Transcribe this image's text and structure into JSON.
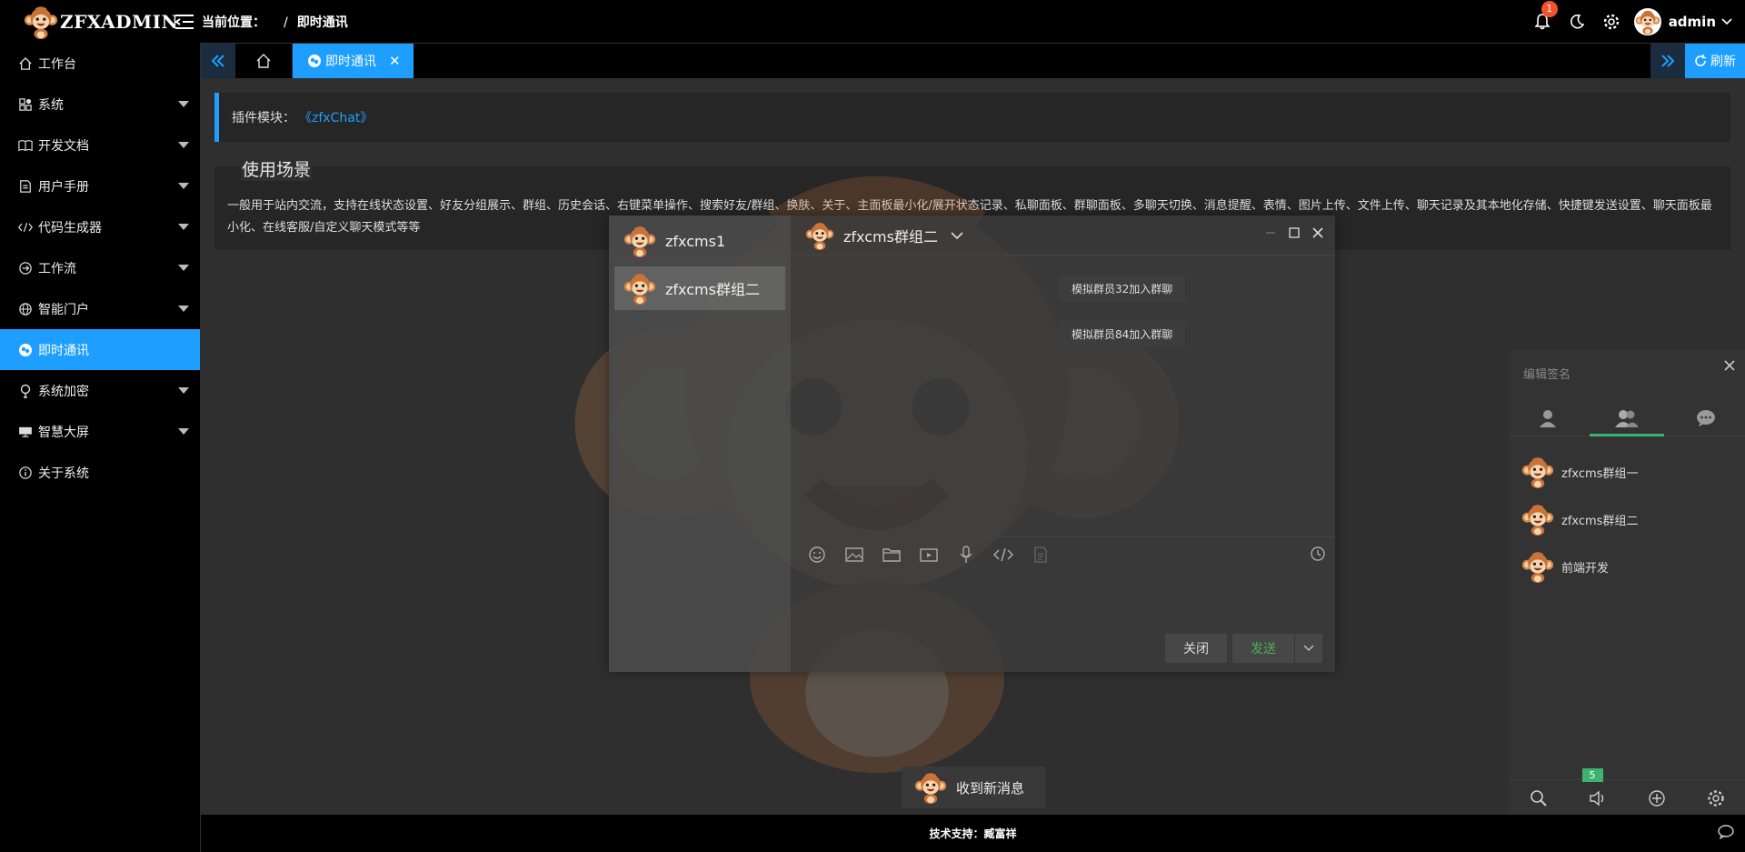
{
  "app": {
    "logo_text": "ZFXADMIN",
    "breadcrumb_label": "当前位置：",
    "breadcrumb_sep": "/",
    "breadcrumb_current": "即时通讯"
  },
  "topbar": {
    "notification_count": "1",
    "username": "admin"
  },
  "sidebar": {
    "items": [
      {
        "label": "工作台",
        "icon": "home-icon",
        "has_caret": false
      },
      {
        "label": "系统",
        "icon": "apps-icon",
        "has_caret": true
      },
      {
        "label": "开发文档",
        "icon": "book-icon",
        "has_caret": true
      },
      {
        "label": "用户手册",
        "icon": "note-icon",
        "has_caret": true
      },
      {
        "label": "代码生成器",
        "icon": "code-icon",
        "has_caret": true
      },
      {
        "label": "工作流",
        "icon": "flow-icon",
        "has_caret": true
      },
      {
        "label": "智能门户",
        "icon": "globe-icon",
        "has_caret": true
      },
      {
        "label": "即时通讯",
        "icon": "chat-icon",
        "has_caret": false,
        "active": true
      },
      {
        "label": "系统加密",
        "icon": "bulb-icon",
        "has_caret": true
      },
      {
        "label": "智慧大屏",
        "icon": "screen-icon",
        "has_caret": true
      },
      {
        "label": "关于系统",
        "icon": "info-icon",
        "has_caret": false
      }
    ]
  },
  "tabs": {
    "active_label": "即时通讯",
    "refresh_label": "刷新"
  },
  "content": {
    "plugin_label": "插件模块：",
    "plugin_link": "《zfxChat》",
    "scene_title": "使用场景",
    "scene_text": "一般用于站内交流，支持在线状态设置、好友分组展示、群组、历史会话、右键菜单操作、搜索好友/群组、换肤、关于、主面板最小化/展开状态记录、私聊面板、群聊面板、多聊天切换、消息提醒、表情、图片上传、文件上传、聊天记录及其本地化存储、快捷键发送设置、聊天面板最小化、在线客服/自定义聊天模式等等"
  },
  "chat": {
    "list": [
      {
        "name": "zfxcms1",
        "selected": false
      },
      {
        "name": "zfxcms群组二",
        "selected": true
      }
    ],
    "header_name": "zfxcms群组二",
    "system_messages": [
      "模拟群员32加入群聊",
      "模拟群员84加入群聊"
    ],
    "toolbar_icons": [
      "emoji-icon",
      "image-icon",
      "folder-icon",
      "video-icon",
      "mic-icon",
      "code-icon",
      "note-icon"
    ],
    "close_label": "关闭",
    "send_label": "发送"
  },
  "panel": {
    "sign_placeholder": "编辑签名",
    "groups": [
      "zfxcms群组一",
      "zfxcms群组二",
      "前端开发"
    ],
    "unread_badge": "5"
  },
  "newmsg": {
    "text": "收到新消息"
  },
  "footer": {
    "text": "技术支持：臧富祥"
  },
  "colors": {
    "accent": "#1e9fff",
    "send": "#4caf50",
    "badge": "#f5512c",
    "online": "#3cb371"
  }
}
